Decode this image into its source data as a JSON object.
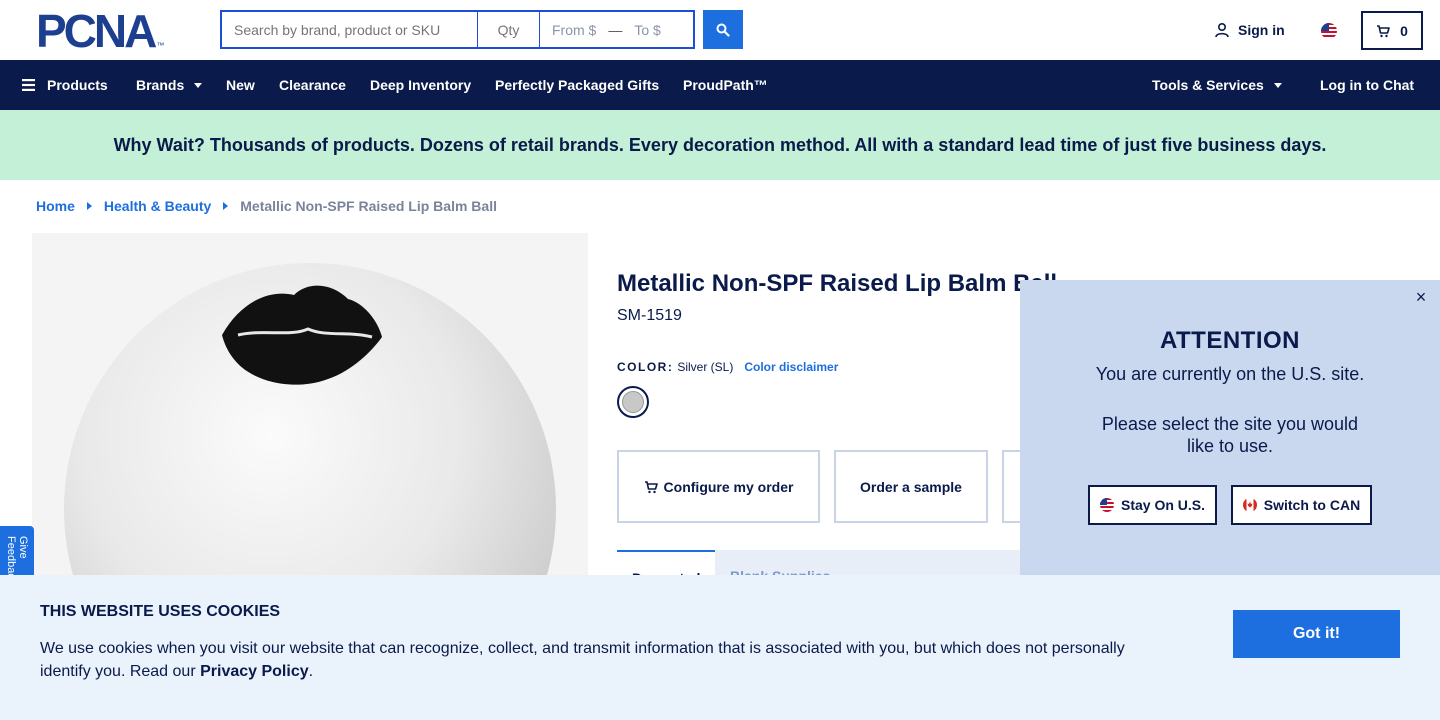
{
  "header": {
    "logo_text": "PCNA",
    "logo_mark": "™",
    "search": {
      "placeholder": "Search by brand, product or SKU"
    },
    "qty": {
      "placeholder": "Qty"
    },
    "price_from": "From $",
    "price_to": "To $",
    "signin_label": "Sign in",
    "cart_count": "0"
  },
  "nav": {
    "items": [
      {
        "label": "Products",
        "icon": "hamburger-icon"
      },
      {
        "label": "Brands",
        "dropdown": true
      },
      {
        "label": "New"
      },
      {
        "label": "Clearance"
      },
      {
        "label": "Deep Inventory"
      },
      {
        "label": "Perfectly Packaged Gifts"
      },
      {
        "label": "ProudPath™"
      },
      {
        "label": "Tools & Services",
        "dropdown": true
      },
      {
        "label": "Log in to Chat"
      }
    ]
  },
  "promo": {
    "text": "Why Wait? Thousands of products. Dozens of retail brands. Every decoration method. All with a standard lead time of just five business days."
  },
  "breadcrumb": {
    "home": "Home",
    "category": "Health & Beauty",
    "current": "Metallic Non-SPF Raised Lip Balm Ball"
  },
  "product": {
    "title": "Metallic Non-SPF Raised Lip Balm Ball",
    "sku": "SM-1519",
    "color_label": "COLOR:",
    "color_value": "Silver (SL)",
    "color_disclaimer": "Color disclaimer",
    "buttons": {
      "configure": "Configure my order",
      "sample": "Order a sample"
    },
    "tabs": {
      "active": "Decorated",
      "other": "Blank     Supplies"
    }
  },
  "feedback_tab": "Give Feedback",
  "attention": {
    "title": "ATTENTION",
    "line1": "You are currently on the U.S. site.",
    "line2": "Please select the site you would like to use.",
    "stay_label": "Stay On U.S.",
    "switch_label": "Switch to CAN",
    "close": "×"
  },
  "cookie": {
    "title": "THIS WEBSITE USES COOKIES",
    "body": "We use cookies when you visit our website that can recognize, collect, and transmit information that is associated with you, but which does not personally identify you. Read our ",
    "link": "Privacy Policy",
    "period": ".",
    "button": "Got it!"
  },
  "colors": {
    "navy": "#0a1a4a",
    "accent_blue": "#1d6fe0",
    "promo_green": "#c3f0d6",
    "modal_blue": "#c9d8ef",
    "cookie_bg": "#eaf2fc"
  }
}
